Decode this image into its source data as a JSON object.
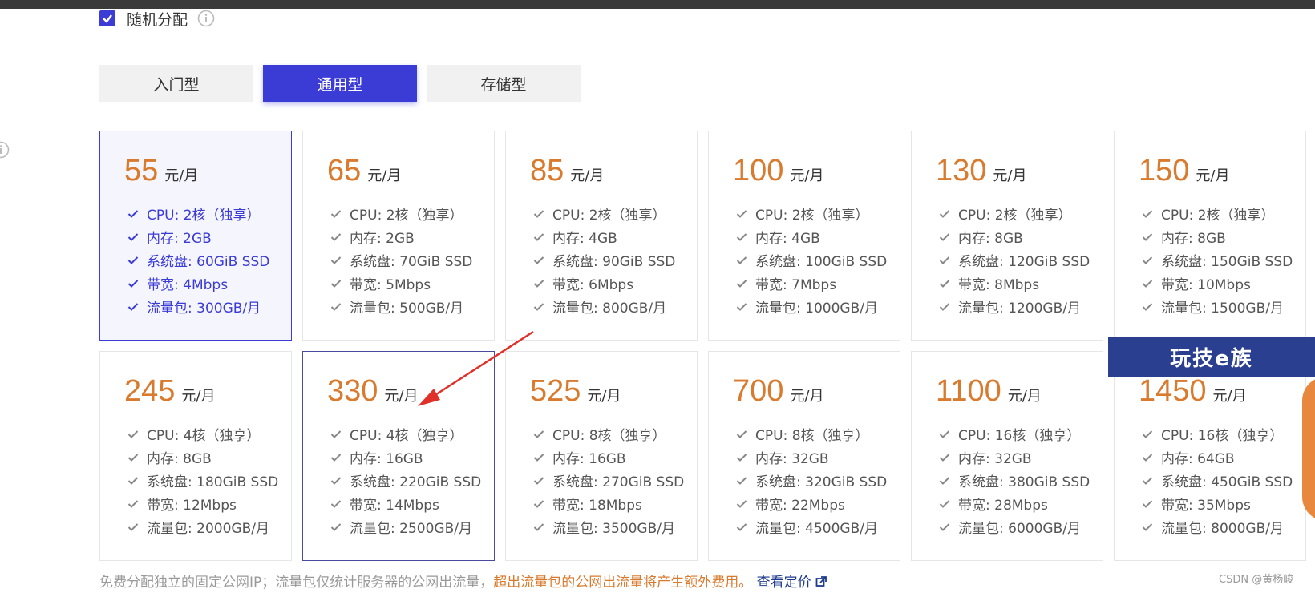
{
  "random_assign": {
    "label": "随机分配",
    "checked": true
  },
  "tabs": [
    {
      "label": "入门型",
      "active": false
    },
    {
      "label": "通用型",
      "active": true
    },
    {
      "label": "存储型",
      "active": false
    }
  ],
  "unit": "元/月",
  "plans": [
    {
      "price": "55",
      "specs": [
        "CPU: 2核（独享）",
        "内存: 2GB",
        "系统盘: 60GiB SSD",
        "带宽: 4Mbps",
        "流量包: 300GB/月"
      ],
      "selected": true
    },
    {
      "price": "65",
      "specs": [
        "CPU: 2核（独享）",
        "内存: 2GB",
        "系统盘: 70GiB SSD",
        "带宽: 5Mbps",
        "流量包: 500GB/月"
      ]
    },
    {
      "price": "85",
      "specs": [
        "CPU: 2核（独享）",
        "内存: 4GB",
        "系统盘: 90GiB SSD",
        "带宽: 6Mbps",
        "流量包: 800GB/月"
      ]
    },
    {
      "price": "100",
      "specs": [
        "CPU: 2核（独享）",
        "内存: 4GB",
        "系统盘: 100GiB SSD",
        "带宽: 7Mbps",
        "流量包: 1000GB/月"
      ]
    },
    {
      "price": "130",
      "specs": [
        "CPU: 2核（独享）",
        "内存: 8GB",
        "系统盘: 120GiB SSD",
        "带宽: 8Mbps",
        "流量包: 1200GB/月"
      ]
    },
    {
      "price": "150",
      "specs": [
        "CPU: 2核（独享）",
        "内存: 8GB",
        "系统盘: 150GiB SSD",
        "带宽: 10Mbps",
        "流量包: 1500GB/月"
      ]
    },
    {
      "price": "245",
      "specs": [
        "CPU: 4核（独享）",
        "内存: 8GB",
        "系统盘: 180GiB SSD",
        "带宽: 12Mbps",
        "流量包: 2000GB/月"
      ]
    },
    {
      "price": "330",
      "specs": [
        "CPU: 4核（独享）",
        "内存: 16GB",
        "系统盘: 220GiB SSD",
        "带宽: 14Mbps",
        "流量包: 2500GB/月"
      ],
      "outlined": true
    },
    {
      "price": "525",
      "specs": [
        "CPU: 8核（独享）",
        "内存: 16GB",
        "系统盘: 270GiB SSD",
        "带宽: 18Mbps",
        "流量包: 3500GB/月"
      ]
    },
    {
      "price": "700",
      "specs": [
        "CPU: 8核（独享）",
        "内存: 32GB",
        "系统盘: 320GiB SSD",
        "带宽: 22Mbps",
        "流量包: 4500GB/月"
      ]
    },
    {
      "price": "1100",
      "specs": [
        "CPU: 16核（独享）",
        "内存: 32GB",
        "系统盘: 380GiB SSD",
        "带宽: 28Mbps",
        "流量包: 6000GB/月"
      ]
    },
    {
      "price": "1450",
      "specs": [
        "CPU: 16核（独享）",
        "内存: 64GB",
        "系统盘: 450GiB SSD",
        "带宽: 35Mbps",
        "流量包: 8000GB/月"
      ]
    }
  ],
  "footer": {
    "note": "免费分配独立的固定公网IP；流量包仅统计服务器的公网出流量，",
    "warning": "超出流量包的公网出流量将产生额外费用。",
    "link": "查看定价"
  },
  "watermark": "玩技e族",
  "credit": "CSDN @黄杨峻",
  "colors": {
    "accent": "#3b3bd6",
    "price": "#d97b2e",
    "arrow": "#e0302a"
  }
}
